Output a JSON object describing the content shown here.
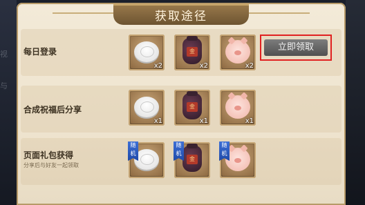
{
  "dialog": {
    "title": "获取途径"
  },
  "background": {
    "left_hints": [
      "视",
      "与"
    ]
  },
  "rows": [
    {
      "label": "每日登录",
      "sublabel": "",
      "items": [
        {
          "icon": "mooncake-icon",
          "qty": "x2"
        },
        {
          "icon": "wine-jar-icon",
          "qty": "x2",
          "jar_mark": "金"
        },
        {
          "icon": "pig-plush-icon",
          "qty": "x2"
        }
      ],
      "button": "立即领取"
    },
    {
      "label": "合成祝福后分享",
      "sublabel": "",
      "items": [
        {
          "icon": "mooncake-icon",
          "qty": "x1"
        },
        {
          "icon": "wine-jar-icon",
          "qty": "x1",
          "jar_mark": "金"
        },
        {
          "icon": "pig-plush-icon",
          "qty": "x1"
        }
      ]
    },
    {
      "label": "页面礼包获得",
      "sublabel": "分享后与好友一起领取",
      "items": [
        {
          "icon": "mooncake-icon",
          "qty": "",
          "tag": "随机"
        },
        {
          "icon": "wine-jar-icon",
          "qty": "",
          "tag": "随机",
          "jar_mark": "金"
        },
        {
          "icon": "pig-plush-icon",
          "qty": "",
          "tag": "随机"
        }
      ]
    }
  ],
  "colors": {
    "highlight_border": "#e02020",
    "header": "#7a5e38"
  }
}
